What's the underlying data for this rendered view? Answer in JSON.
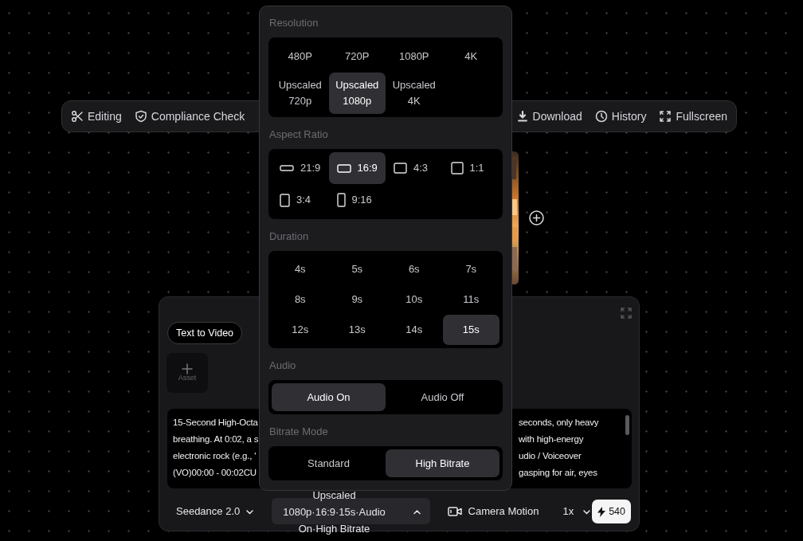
{
  "toolbar": {
    "left_items": [
      {
        "label": "Editing"
      },
      {
        "label": "Compliance Check"
      }
    ],
    "right_items": [
      {
        "label": "Download"
      },
      {
        "label": "History"
      },
      {
        "label": "Fullscreen"
      }
    ]
  },
  "panel": {
    "tabs": [
      {
        "label": "Text to Video",
        "selected": true
      }
    ],
    "asset_button": {
      "label": "Asset"
    },
    "prompt": {
      "left_lines": [
        "15-Second High-Octa",
        "breathing. At 0:02, a s",
        "electronic rock (e.g., '",
        "(VO)00:00 - 00:02CU"
      ],
      "right_lines": [
        "seconds, only heavy",
        "with high-energy",
        "udio / Voiceover",
        "gasping for air, eyes"
      ]
    },
    "model": {
      "label": "Seedance 2.0"
    },
    "settings_button": {
      "label": "Upscaled 1080p·16:9·15s·Audio On·High Bitrate",
      "expanded": true
    },
    "camera_button": {
      "label": "Camera Motion"
    },
    "speed": {
      "label": "1x"
    },
    "credits": {
      "label": "540"
    }
  },
  "settings_popup": {
    "sections": [
      {
        "title": "Resolution",
        "kind": "grid",
        "options": [
          {
            "label": "480P",
            "selected": false
          },
          {
            "label": "720P",
            "selected": false
          },
          {
            "label": "1080P",
            "selected": false
          },
          {
            "label": "4K",
            "selected": false
          },
          {
            "label": "Upscaled 720p",
            "selected": false
          },
          {
            "label": "Upscaled 1080p",
            "selected": true
          },
          {
            "label": "Upscaled 4K",
            "selected": false
          }
        ]
      },
      {
        "title": "Aspect Ratio",
        "kind": "ratio",
        "options": [
          {
            "label": "21:9",
            "selected": false
          },
          {
            "label": "16:9",
            "selected": true
          },
          {
            "label": "4:3",
            "selected": false
          },
          {
            "label": "1:1",
            "selected": false
          },
          {
            "label": "3:4",
            "selected": false
          },
          {
            "label": "9:16",
            "selected": false
          }
        ]
      },
      {
        "title": "Duration",
        "kind": "grid",
        "options": [
          {
            "label": "4s",
            "selected": false
          },
          {
            "label": "5s",
            "selected": false
          },
          {
            "label": "6s",
            "selected": false
          },
          {
            "label": "7s",
            "selected": false
          },
          {
            "label": "8s",
            "selected": false
          },
          {
            "label": "9s",
            "selected": false
          },
          {
            "label": "10s",
            "selected": false
          },
          {
            "label": "11s",
            "selected": false
          },
          {
            "label": "12s",
            "selected": false
          },
          {
            "label": "13s",
            "selected": false
          },
          {
            "label": "14s",
            "selected": false
          },
          {
            "label": "15s",
            "selected": true
          }
        ]
      },
      {
        "title": "Audio",
        "kind": "pair",
        "options": [
          {
            "label": "Audio On",
            "selected": true
          },
          {
            "label": "Audio Off",
            "selected": false
          }
        ]
      },
      {
        "title": "Bitrate Mode",
        "kind": "pair",
        "options": [
          {
            "label": "Standard",
            "selected": false
          },
          {
            "label": "High Bitrate",
            "selected": true
          }
        ]
      }
    ]
  }
}
